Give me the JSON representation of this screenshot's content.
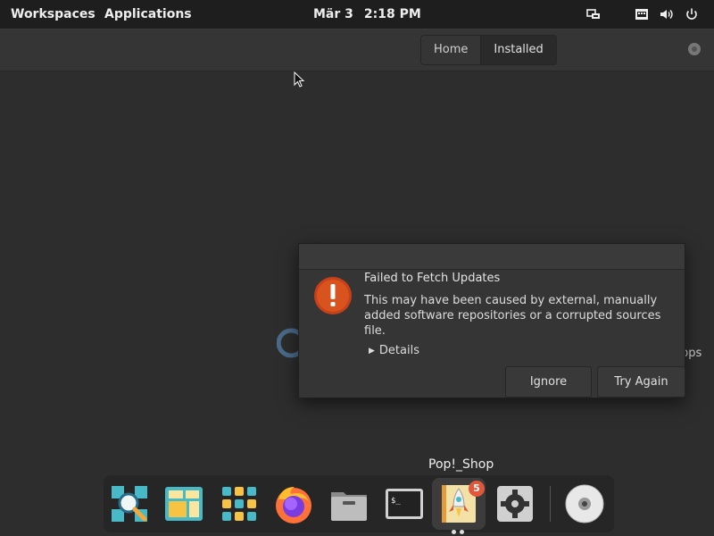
{
  "top_panel": {
    "workspaces_label": "Workspaces",
    "applications_label": "Applications",
    "date": "Mär 3",
    "time": "2:18 PM",
    "tray_icons": [
      "network-icon",
      "keyboard-icon",
      "volume-icon",
      "power-icon"
    ]
  },
  "app": {
    "tabs": [
      {
        "label": "Home",
        "active": false
      },
      {
        "label": "Installed",
        "active": true
      }
    ],
    "background_text": "pps"
  },
  "dialog": {
    "title": "Failed to Fetch Updates",
    "message": "This may have been caused by external, manually added software repositories or a corrupted sources file.",
    "details_label": "Details",
    "ignore_label": "Ignore",
    "try_again_label": "Try Again",
    "icon": "error-icon",
    "accent_color": "#d9531e"
  },
  "dock": {
    "tooltip": "Pop!_Shop",
    "items": [
      {
        "name": "search-app-icon"
      },
      {
        "name": "workspaces-app-icon"
      },
      {
        "name": "app-grid-icon"
      },
      {
        "name": "firefox-icon"
      },
      {
        "name": "files-icon"
      },
      {
        "name": "terminal-icon"
      },
      {
        "name": "pop-shop-icon",
        "badge": "5"
      },
      {
        "name": "settings-icon"
      },
      {
        "name": "disc-icon"
      }
    ]
  }
}
